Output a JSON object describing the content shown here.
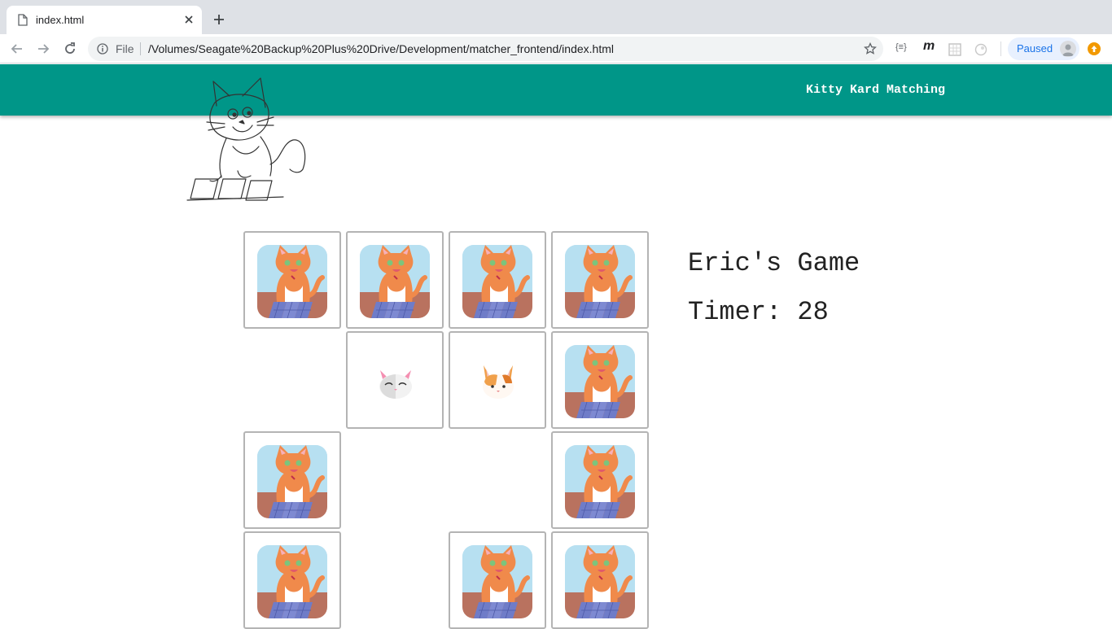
{
  "browser": {
    "tab_title": "index.html",
    "url_scheme": "File",
    "url": "/Volumes/Seagate%20Backup%20Plus%20Drive/Development/matcher_frontend/index.html",
    "profile_status": "Paused",
    "extensions": [
      "{≡}",
      "m"
    ]
  },
  "app": {
    "title": "Kitty Kard Matching",
    "accent_color": "#009688"
  },
  "game": {
    "player_title": "Eric's Game",
    "timer_label": "Timer: 28",
    "board": [
      [
        "hidden",
        "hidden",
        "hidden",
        "hidden"
      ],
      [
        "matched",
        "white-cat",
        "calico-cat",
        "hidden"
      ],
      [
        "hidden",
        "matched",
        "matched",
        "hidden"
      ],
      [
        "hidden",
        "matched",
        "hidden",
        "hidden"
      ]
    ]
  }
}
